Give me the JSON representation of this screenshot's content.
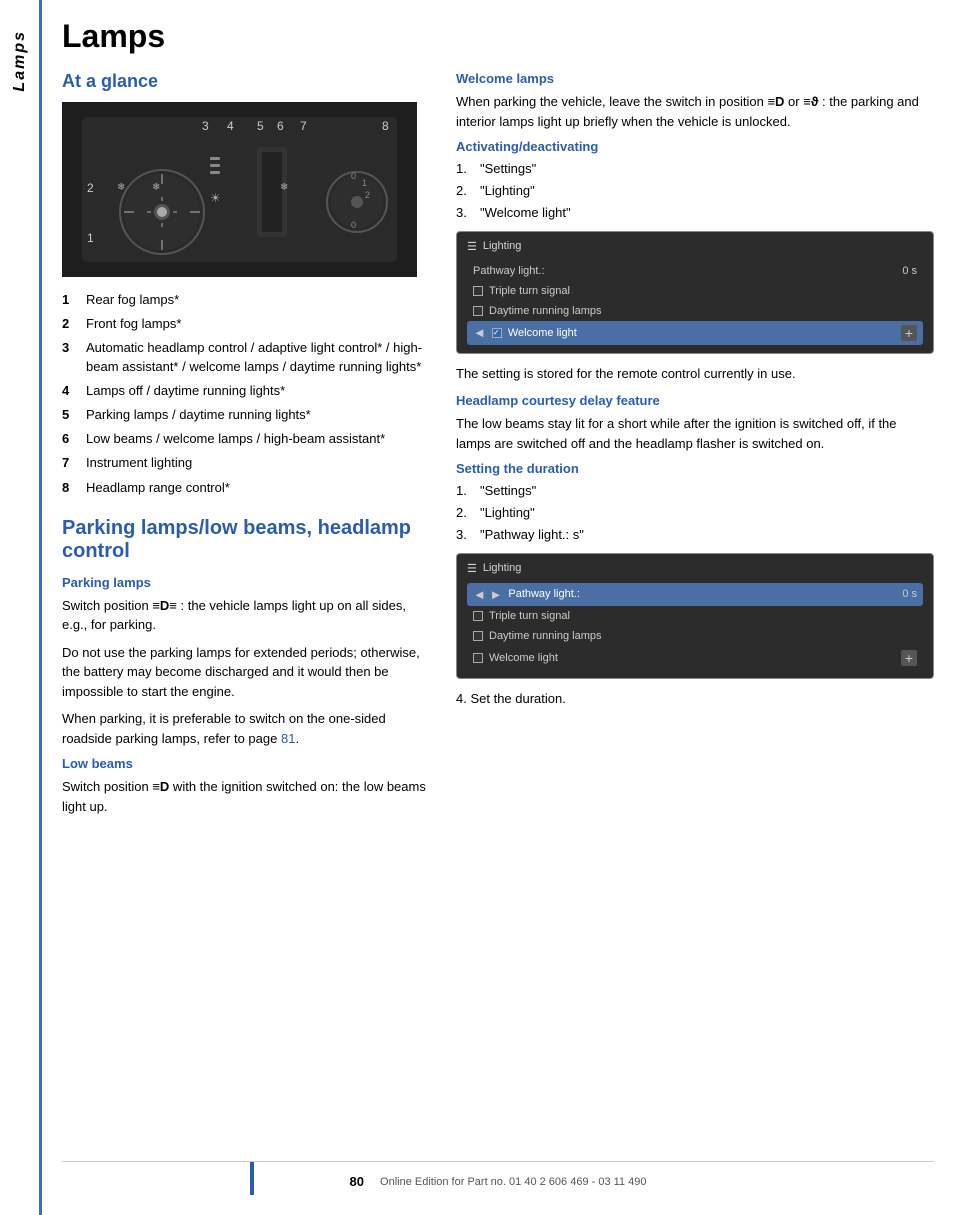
{
  "page": {
    "title": "Lamps",
    "sidebar_label": "Lamps",
    "page_number": "80",
    "footer_text": "Online Edition for Part no. 01 40 2 606 469 - 03 11 490"
  },
  "left_col": {
    "section1_heading": "At a glance",
    "components": [
      {
        "num": "1",
        "text": "Rear fog lamps*"
      },
      {
        "num": "2",
        "text": "Front fog lamps*"
      },
      {
        "num": "3",
        "text": "Automatic headlamp control / adaptive light control* / high-beam assistant* / welcome lamps / daytime running lights*"
      },
      {
        "num": "4",
        "text": "Lamps off / daytime running lights*"
      },
      {
        "num": "5",
        "text": "Parking lamps / daytime running lights*"
      },
      {
        "num": "6",
        "text": "Low beams / welcome lamps / high-beam assistant*"
      },
      {
        "num": "7",
        "text": "Instrument lighting"
      },
      {
        "num": "8",
        "text": "Headlamp range control*"
      }
    ],
    "section2_heading": "Parking lamps/low beams, headlamp control",
    "parking_lamps_heading": "Parking lamps",
    "parking_lamps_p1": "Switch position ≡D≡ : the vehicle lamps light up on all sides, e.g., for parking.",
    "parking_lamps_p2": "Do not use the parking lamps for extended periods; otherwise, the battery may become discharged and it would then be impossible to start the engine.",
    "parking_lamps_p3": "When parking, it is preferable to switch on the one-sided roadside parking lamps, refer to page 81.",
    "low_beams_heading": "Low beams",
    "low_beams_p1": "Switch position ≡D with the ignition switched on: the low beams light up."
  },
  "right_col": {
    "welcome_lamps_heading": "Welcome lamps",
    "welcome_lamps_p1": "When parking the vehicle, leave the switch in position ≡D or ≡сғ : the parking and interior lamps light up briefly when the vehicle is unlocked.",
    "activating_heading": "Activating/deactivating",
    "activating_steps": [
      {
        "n": "1.",
        "text": "\"Settings\""
      },
      {
        "n": "2.",
        "text": "\"Lighting\""
      },
      {
        "n": "3.",
        "text": "\"Welcome light\""
      }
    ],
    "lighting_ui_1": {
      "title": "Lighting",
      "pathway_label": "Pathway light.:",
      "pathway_value": "0 s",
      "row1_label": "Triple turn signal",
      "row2_label": "Daytime running lamps",
      "row3_label": "Welcome light",
      "row3_checked": true
    },
    "setting_stored_text": "The setting is stored for the remote control currently in use.",
    "headlamp_delay_heading": "Headlamp courtesy delay feature",
    "headlamp_delay_p1": "The low beams stay lit for a short while after the ignition is switched off, if the lamps are switched off and the headlamp flasher is switched on.",
    "setting_duration_heading": "Setting the duration",
    "setting_duration_steps": [
      {
        "n": "1.",
        "text": "\"Settings\""
      },
      {
        "n": "2.",
        "text": "\"Lighting\""
      },
      {
        "n": "3.",
        "text": "\"Pathway light.: s\""
      }
    ],
    "lighting_ui_2": {
      "title": "Lighting",
      "pathway_label": "Pathway light.:",
      "pathway_value": "0 s",
      "row1_label": "Triple turn signal",
      "row2_label": "Daytime running lamps",
      "row3_label": "Welcome light",
      "highlighted_row": "pathway"
    },
    "step4_text": "4.   Set the duration."
  }
}
